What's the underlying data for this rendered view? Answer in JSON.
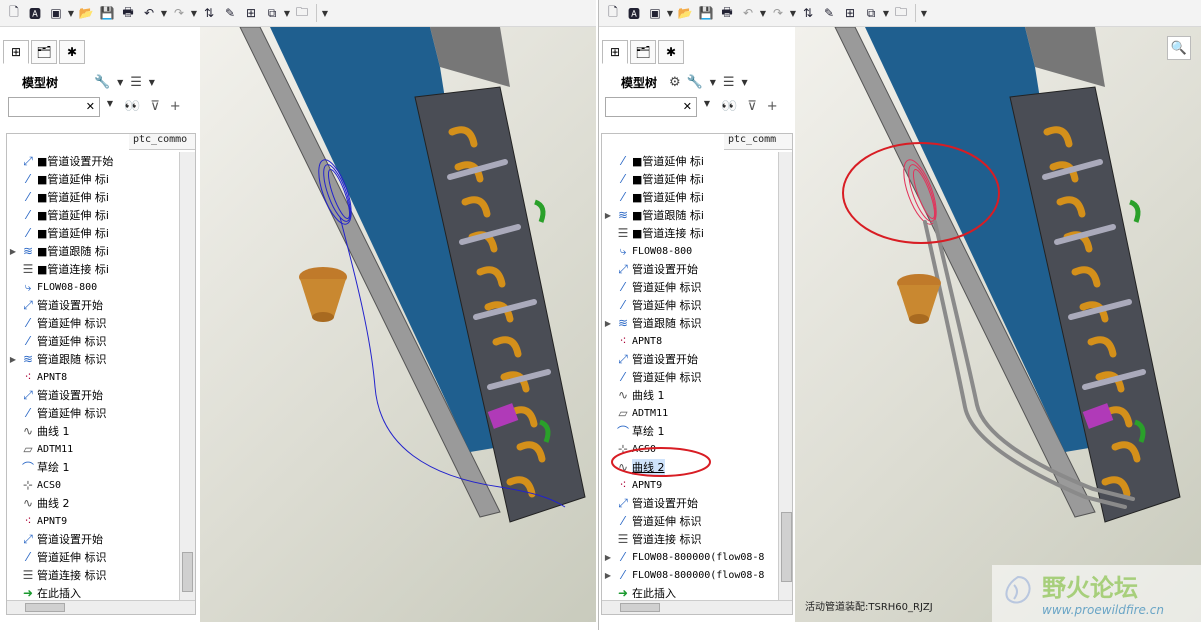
{
  "left": {
    "model_tree_label": "模型树",
    "column_header": "ptc_commo",
    "tree_items": [
      {
        "icon": "pipe-start-icon",
        "label": "■管道设置开始",
        "expand": false
      },
      {
        "icon": "pipe-extend-icon",
        "label": "■管道延伸 标i",
        "expand": false
      },
      {
        "icon": "pipe-extend-icon",
        "label": "■管道延伸 标i",
        "expand": false
      },
      {
        "icon": "pipe-extend-icon",
        "label": "■管道延伸 标i",
        "expand": false
      },
      {
        "icon": "pipe-extend-icon",
        "label": "■管道延伸 标i",
        "expand": false
      },
      {
        "icon": "pipe-follow-icon",
        "label": "■管道跟随 标i",
        "expand": true
      },
      {
        "icon": "pipe-connect-icon",
        "label": "■管道连接 标i",
        "expand": false
      },
      {
        "icon": "flow-icon",
        "label": "FLOW08-800",
        "expand": false
      },
      {
        "icon": "pipe-start-icon",
        "label": "管道设置开始",
        "expand": false
      },
      {
        "icon": "pipe-extend-icon",
        "label": "管道延伸 标识",
        "expand": false
      },
      {
        "icon": "pipe-extend-icon",
        "label": "管道延伸 标识",
        "expand": false
      },
      {
        "icon": "pipe-follow-icon",
        "label": "管道跟随 标识",
        "expand": true
      },
      {
        "icon": "datum-point-icon",
        "label": "APNT8",
        "expand": false
      },
      {
        "icon": "pipe-start-icon",
        "label": "管道设置开始",
        "expand": false
      },
      {
        "icon": "pipe-extend-icon",
        "label": "管道延伸 标识",
        "expand": false
      },
      {
        "icon": "curve-icon",
        "label": "曲线 1",
        "expand": false
      },
      {
        "icon": "datum-plane-icon",
        "label": "ADTM11",
        "expand": false
      },
      {
        "icon": "sketch-icon",
        "label": "草绘 1",
        "expand": false
      },
      {
        "icon": "coord-sys-icon",
        "label": "ACS0",
        "expand": false
      },
      {
        "icon": "curve-icon",
        "label": "曲线 2",
        "expand": false
      },
      {
        "icon": "datum-point-icon",
        "label": "APNT9",
        "expand": false
      },
      {
        "icon": "pipe-start-icon",
        "label": "管道设置开始",
        "expand": false
      },
      {
        "icon": "pipe-extend-icon",
        "label": "管道延伸 标识",
        "expand": false
      },
      {
        "icon": "pipe-connect-icon",
        "label": "管道连接 标识",
        "expand": false
      },
      {
        "icon": "insert-here-icon",
        "label": "在此插入",
        "expand": false
      }
    ]
  },
  "right": {
    "model_tree_label": "模型树",
    "column_header": "ptc_comm",
    "tree_items": [
      {
        "icon": "pipe-extend-icon",
        "label": "■管道延伸 标i",
        "expand": false
      },
      {
        "icon": "pipe-extend-icon",
        "label": "■管道延伸 标i",
        "expand": false
      },
      {
        "icon": "pipe-extend-icon",
        "label": "■管道延伸 标i",
        "expand": false
      },
      {
        "icon": "pipe-follow-icon",
        "label": "■管道跟随 标i",
        "expand": true
      },
      {
        "icon": "pipe-connect-icon",
        "label": "■管道连接 标i",
        "expand": false
      },
      {
        "icon": "flow-icon",
        "label": "FLOW08-800",
        "expand": false
      },
      {
        "icon": "pipe-start-icon",
        "label": "管道设置开始",
        "expand": false
      },
      {
        "icon": "pipe-extend-icon",
        "label": "管道延伸 标识",
        "expand": false
      },
      {
        "icon": "pipe-extend-icon",
        "label": "管道延伸 标识",
        "expand": false
      },
      {
        "icon": "pipe-follow-icon",
        "label": "管道跟随 标识",
        "expand": true
      },
      {
        "icon": "datum-point-icon",
        "label": "APNT8",
        "expand": false
      },
      {
        "icon": "pipe-start-icon",
        "label": "管道设置开始",
        "expand": false
      },
      {
        "icon": "pipe-extend-icon",
        "label": "管道延伸 标识",
        "expand": false
      },
      {
        "icon": "curve-icon",
        "label": "曲线 1",
        "expand": false
      },
      {
        "icon": "datum-plane-icon",
        "label": "ADTM11",
        "expand": false
      },
      {
        "icon": "sketch-icon",
        "label": "草绘 1",
        "expand": false
      },
      {
        "icon": "coord-sys-icon",
        "label": "ACS0",
        "expand": false
      },
      {
        "icon": "curve-icon",
        "label": "曲线 2",
        "expand": false,
        "highlight": true
      },
      {
        "icon": "datum-point-icon",
        "label": "APNT9",
        "expand": false
      },
      {
        "icon": "pipe-start-icon",
        "label": "管道设置开始",
        "expand": false
      },
      {
        "icon": "pipe-extend-icon",
        "label": "管道延伸 标识",
        "expand": false
      },
      {
        "icon": "pipe-connect-icon",
        "label": "管道连接 标识",
        "expand": false
      },
      {
        "icon": "flow-pipe-icon",
        "label": "FLOW08-800000(flow08-8",
        "expand": true
      },
      {
        "icon": "flow-pipe-icon",
        "label": "FLOW08-800000(flow08-8",
        "expand": true
      },
      {
        "icon": "insert-here-icon",
        "label": "在此插入",
        "expand": false
      }
    ],
    "status_text": "活动管道装配:TSRH60_RJZJ"
  },
  "watermark": {
    "title": "野火论坛",
    "url": "www.proewildfire.cn"
  },
  "colors": {
    "highlight_red": "#d81d24",
    "curve_blue": "#2222cc",
    "panel_blue": "#1f5f8f",
    "copper": "#d4901a"
  }
}
